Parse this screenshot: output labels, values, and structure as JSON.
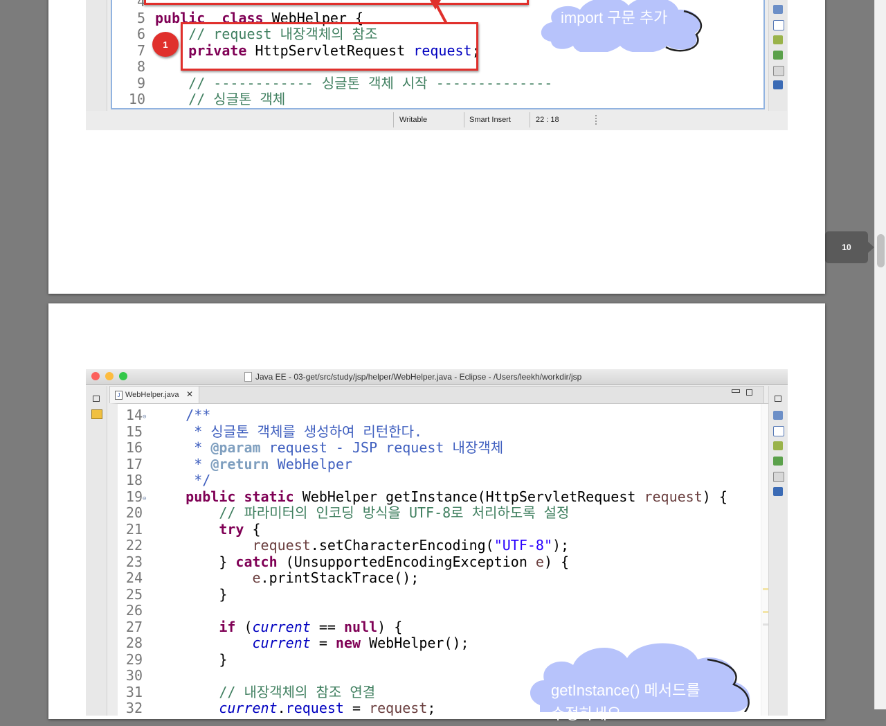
{
  "page_badge": "10",
  "top_shot": {
    "lines": [
      {
        "n": "4",
        "tokens": []
      },
      {
        "n": "5",
        "tokens": [
          [
            "kw",
            "public"
          ],
          [
            "",
            "  "
          ],
          [
            "kw",
            "class"
          ],
          [
            "",
            " WebHelper {"
          ]
        ]
      },
      {
        "n": "6",
        "tokens": [
          [
            "",
            ""
          ],
          [
            "cm",
            "// request 내장객체의 참조"
          ]
        ]
      },
      {
        "n": "7",
        "tokens": [
          [
            "kw",
            "private"
          ],
          [
            "",
            " HttpServletRequest "
          ],
          [
            "fi",
            "request"
          ],
          [
            "",
            ";"
          ]
        ]
      },
      {
        "n": "8",
        "tokens": []
      },
      {
        "n": "9",
        "tokens": [
          [
            "",
            ""
          ],
          [
            "cm",
            "// ------------ 싱글톤 객체 시작 --------------"
          ]
        ]
      },
      {
        "n": "10",
        "tokens": [
          [
            "",
            ""
          ],
          [
            "cm",
            "// 싱글톤 객체"
          ]
        ]
      }
    ],
    "status": {
      "writable": "Writable",
      "insert": "Smart Insert",
      "position": "22 : 18"
    },
    "callout_number": "1",
    "cloud_text": "import 구문 추가"
  },
  "bottom_shot": {
    "window_title": "Java EE - 03-get/src/study/jsp/helper/WebHelper.java - Eclipse - /Users/leekh/workdir/jsp",
    "tab_label": "WebHelper.java",
    "lines": [
      {
        "n": "14",
        "fold": true,
        "ind": "    ",
        "tokens": [
          [
            "jd",
            "/**"
          ]
        ]
      },
      {
        "n": "15",
        "ind": "     ",
        "tokens": [
          [
            "jd",
            "* 싱글톤 객체를 생성하여 리턴한다."
          ]
        ]
      },
      {
        "n": "16",
        "ind": "     ",
        "tokens": [
          [
            "jd",
            "* "
          ],
          [
            "tg",
            "@param"
          ],
          [
            "jd",
            " request - JSP request 내장객체"
          ]
        ]
      },
      {
        "n": "17",
        "ind": "     ",
        "tokens": [
          [
            "jd",
            "* "
          ],
          [
            "tg",
            "@return"
          ],
          [
            "jd",
            " WebHelper"
          ]
        ]
      },
      {
        "n": "18",
        "ind": "     ",
        "tokens": [
          [
            "jd",
            "*/"
          ]
        ]
      },
      {
        "n": "19",
        "fold": true,
        "ind": "    ",
        "tokens": [
          [
            "kw",
            "public"
          ],
          [
            "",
            " "
          ],
          [
            "kw",
            "static"
          ],
          [
            "",
            " WebHelper getInstance(HttpServletRequest "
          ],
          [
            "lv",
            "request"
          ],
          [
            "",
            ") {"
          ]
        ]
      },
      {
        "n": "20",
        "ind": "        ",
        "tokens": [
          [
            "cm",
            "// 파라미터의 인코딩 방식을 UTF-8로 처리하도록 설정"
          ]
        ]
      },
      {
        "n": "21",
        "ind": "        ",
        "tokens": [
          [
            "kw",
            "try"
          ],
          [
            "",
            " {"
          ]
        ]
      },
      {
        "n": "22",
        "ind": "            ",
        "tokens": [
          [
            "lv",
            "request"
          ],
          [
            "",
            ".setCharacterEncoding("
          ],
          [
            "st",
            "\"UTF-8\""
          ],
          [
            "",
            ");"
          ]
        ]
      },
      {
        "n": "23",
        "ind": "        ",
        "tokens": [
          [
            "",
            "} "
          ],
          [
            "kw",
            "catch"
          ],
          [
            "",
            " (UnsupportedEncodingException "
          ],
          [
            "lv",
            "e"
          ],
          [
            "",
            ") {"
          ]
        ]
      },
      {
        "n": "24",
        "ind": "            ",
        "tokens": [
          [
            "lv",
            "e"
          ],
          [
            "",
            ".printStackTrace();"
          ]
        ]
      },
      {
        "n": "25",
        "ind": "        ",
        "tokens": [
          [
            "",
            "}"
          ]
        ]
      },
      {
        "n": "26",
        "ind": "",
        "tokens": []
      },
      {
        "n": "27",
        "ind": "        ",
        "tokens": [
          [
            "kw",
            "if"
          ],
          [
            "",
            " ("
          ],
          [
            "fs",
            "current"
          ],
          [
            "",
            " == "
          ],
          [
            "kw",
            "null"
          ],
          [
            "",
            ") {"
          ]
        ]
      },
      {
        "n": "28",
        "ind": "            ",
        "tokens": [
          [
            "fs",
            "current"
          ],
          [
            "",
            " = "
          ],
          [
            "kw",
            "new"
          ],
          [
            "",
            " WebHelper();"
          ]
        ]
      },
      {
        "n": "29",
        "ind": "        ",
        "tokens": [
          [
            "",
            "}"
          ]
        ]
      },
      {
        "n": "30",
        "ind": "",
        "tokens": []
      },
      {
        "n": "31",
        "ind": "        ",
        "tokens": [
          [
            "cm",
            "// 내장객체의 참조 연결"
          ]
        ]
      },
      {
        "n": "32",
        "ind": "        ",
        "tokens": [
          [
            "fs",
            "current"
          ],
          [
            "",
            "."
          ],
          [
            "fi",
            "request"
          ],
          [
            "",
            " = "
          ],
          [
            "lv",
            "request"
          ],
          [
            "",
            ";"
          ]
        ]
      }
    ],
    "cloud_text_line1": "getInstance() 메서드를",
    "cloud_text_line2": "수정하세요"
  },
  "colors": {
    "accent_red": "#e0302c",
    "cloud": "#b7c3fb",
    "badge": "#5a5a5a"
  }
}
